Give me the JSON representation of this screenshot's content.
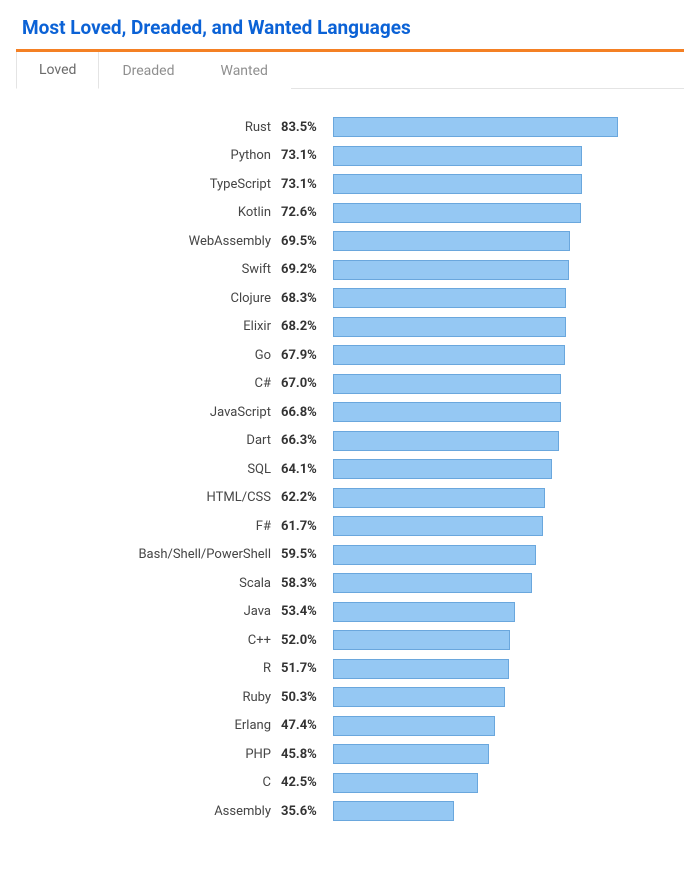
{
  "title": "Most Loved, Dreaded, and Wanted Languages",
  "tabs": [
    {
      "label": "Loved",
      "active": true
    },
    {
      "label": "Dreaded",
      "active": false
    },
    {
      "label": "Wanted",
      "active": false
    }
  ],
  "chart_data": {
    "type": "bar",
    "orientation": "horizontal",
    "xlim": [
      0,
      100
    ],
    "title": "Most Loved, Dreaded, and Wanted Languages",
    "xlabel": "",
    "ylabel": "",
    "categories": [
      "Rust",
      "Python",
      "TypeScript",
      "Kotlin",
      "WebAssembly",
      "Swift",
      "Clojure",
      "Elixir",
      "Go",
      "C#",
      "JavaScript",
      "Dart",
      "SQL",
      "HTML/CSS",
      "F#",
      "Bash/Shell/PowerShell",
      "Scala",
      "Java",
      "C++",
      "R",
      "Ruby",
      "Erlang",
      "PHP",
      "C",
      "Assembly"
    ],
    "values": [
      83.5,
      73.1,
      73.1,
      72.6,
      69.5,
      69.2,
      68.3,
      68.2,
      67.9,
      67.0,
      66.8,
      66.3,
      64.1,
      62.2,
      61.7,
      59.5,
      58.3,
      53.4,
      52.0,
      51.7,
      50.3,
      47.4,
      45.8,
      42.5,
      35.6
    ],
    "bar_color": "#95c8f3",
    "bar_border": "#6aa7dd"
  }
}
